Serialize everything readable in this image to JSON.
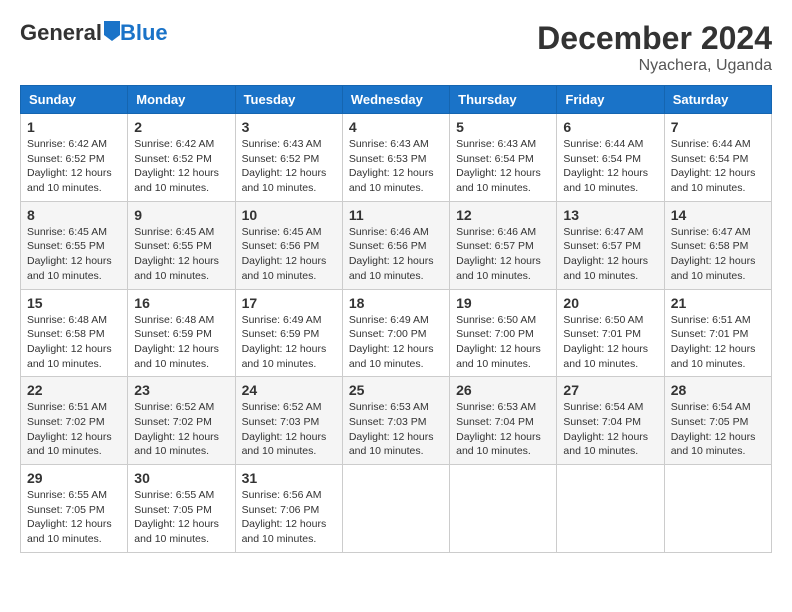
{
  "logo": {
    "general": "General",
    "blue": "Blue"
  },
  "title": "December 2024",
  "location": "Nyachera, Uganda",
  "days_header": [
    "Sunday",
    "Monday",
    "Tuesday",
    "Wednesday",
    "Thursday",
    "Friday",
    "Saturday"
  ],
  "weeks": [
    [
      {
        "day": "1",
        "sunrise": "6:42 AM",
        "sunset": "6:52 PM",
        "daylight": "12 hours and 10 minutes."
      },
      {
        "day": "2",
        "sunrise": "6:42 AM",
        "sunset": "6:52 PM",
        "daylight": "12 hours and 10 minutes."
      },
      {
        "day": "3",
        "sunrise": "6:43 AM",
        "sunset": "6:52 PM",
        "daylight": "12 hours and 10 minutes."
      },
      {
        "day": "4",
        "sunrise": "6:43 AM",
        "sunset": "6:53 PM",
        "daylight": "12 hours and 10 minutes."
      },
      {
        "day": "5",
        "sunrise": "6:43 AM",
        "sunset": "6:54 PM",
        "daylight": "12 hours and 10 minutes."
      },
      {
        "day": "6",
        "sunrise": "6:44 AM",
        "sunset": "6:54 PM",
        "daylight": "12 hours and 10 minutes."
      },
      {
        "day": "7",
        "sunrise": "6:44 AM",
        "sunset": "6:54 PM",
        "daylight": "12 hours and 10 minutes."
      }
    ],
    [
      {
        "day": "8",
        "sunrise": "6:45 AM",
        "sunset": "6:55 PM",
        "daylight": "12 hours and 10 minutes."
      },
      {
        "day": "9",
        "sunrise": "6:45 AM",
        "sunset": "6:55 PM",
        "daylight": "12 hours and 10 minutes."
      },
      {
        "day": "10",
        "sunrise": "6:45 AM",
        "sunset": "6:56 PM",
        "daylight": "12 hours and 10 minutes."
      },
      {
        "day": "11",
        "sunrise": "6:46 AM",
        "sunset": "6:56 PM",
        "daylight": "12 hours and 10 minutes."
      },
      {
        "day": "12",
        "sunrise": "6:46 AM",
        "sunset": "6:57 PM",
        "daylight": "12 hours and 10 minutes."
      },
      {
        "day": "13",
        "sunrise": "6:47 AM",
        "sunset": "6:57 PM",
        "daylight": "12 hours and 10 minutes."
      },
      {
        "day": "14",
        "sunrise": "6:47 AM",
        "sunset": "6:58 PM",
        "daylight": "12 hours and 10 minutes."
      }
    ],
    [
      {
        "day": "15",
        "sunrise": "6:48 AM",
        "sunset": "6:58 PM",
        "daylight": "12 hours and 10 minutes."
      },
      {
        "day": "16",
        "sunrise": "6:48 AM",
        "sunset": "6:59 PM",
        "daylight": "12 hours and 10 minutes."
      },
      {
        "day": "17",
        "sunrise": "6:49 AM",
        "sunset": "6:59 PM",
        "daylight": "12 hours and 10 minutes."
      },
      {
        "day": "18",
        "sunrise": "6:49 AM",
        "sunset": "7:00 PM",
        "daylight": "12 hours and 10 minutes."
      },
      {
        "day": "19",
        "sunrise": "6:50 AM",
        "sunset": "7:00 PM",
        "daylight": "12 hours and 10 minutes."
      },
      {
        "day": "20",
        "sunrise": "6:50 AM",
        "sunset": "7:01 PM",
        "daylight": "12 hours and 10 minutes."
      },
      {
        "day": "21",
        "sunrise": "6:51 AM",
        "sunset": "7:01 PM",
        "daylight": "12 hours and 10 minutes."
      }
    ],
    [
      {
        "day": "22",
        "sunrise": "6:51 AM",
        "sunset": "7:02 PM",
        "daylight": "12 hours and 10 minutes."
      },
      {
        "day": "23",
        "sunrise": "6:52 AM",
        "sunset": "7:02 PM",
        "daylight": "12 hours and 10 minutes."
      },
      {
        "day": "24",
        "sunrise": "6:52 AM",
        "sunset": "7:03 PM",
        "daylight": "12 hours and 10 minutes."
      },
      {
        "day": "25",
        "sunrise": "6:53 AM",
        "sunset": "7:03 PM",
        "daylight": "12 hours and 10 minutes."
      },
      {
        "day": "26",
        "sunrise": "6:53 AM",
        "sunset": "7:04 PM",
        "daylight": "12 hours and 10 minutes."
      },
      {
        "day": "27",
        "sunrise": "6:54 AM",
        "sunset": "7:04 PM",
        "daylight": "12 hours and 10 minutes."
      },
      {
        "day": "28",
        "sunrise": "6:54 AM",
        "sunset": "7:05 PM",
        "daylight": "12 hours and 10 minutes."
      }
    ],
    [
      {
        "day": "29",
        "sunrise": "6:55 AM",
        "sunset": "7:05 PM",
        "daylight": "12 hours and 10 minutes."
      },
      {
        "day": "30",
        "sunrise": "6:55 AM",
        "sunset": "7:05 PM",
        "daylight": "12 hours and 10 minutes."
      },
      {
        "day": "31",
        "sunrise": "6:56 AM",
        "sunset": "7:06 PM",
        "daylight": "12 hours and 10 minutes."
      },
      null,
      null,
      null,
      null
    ]
  ]
}
